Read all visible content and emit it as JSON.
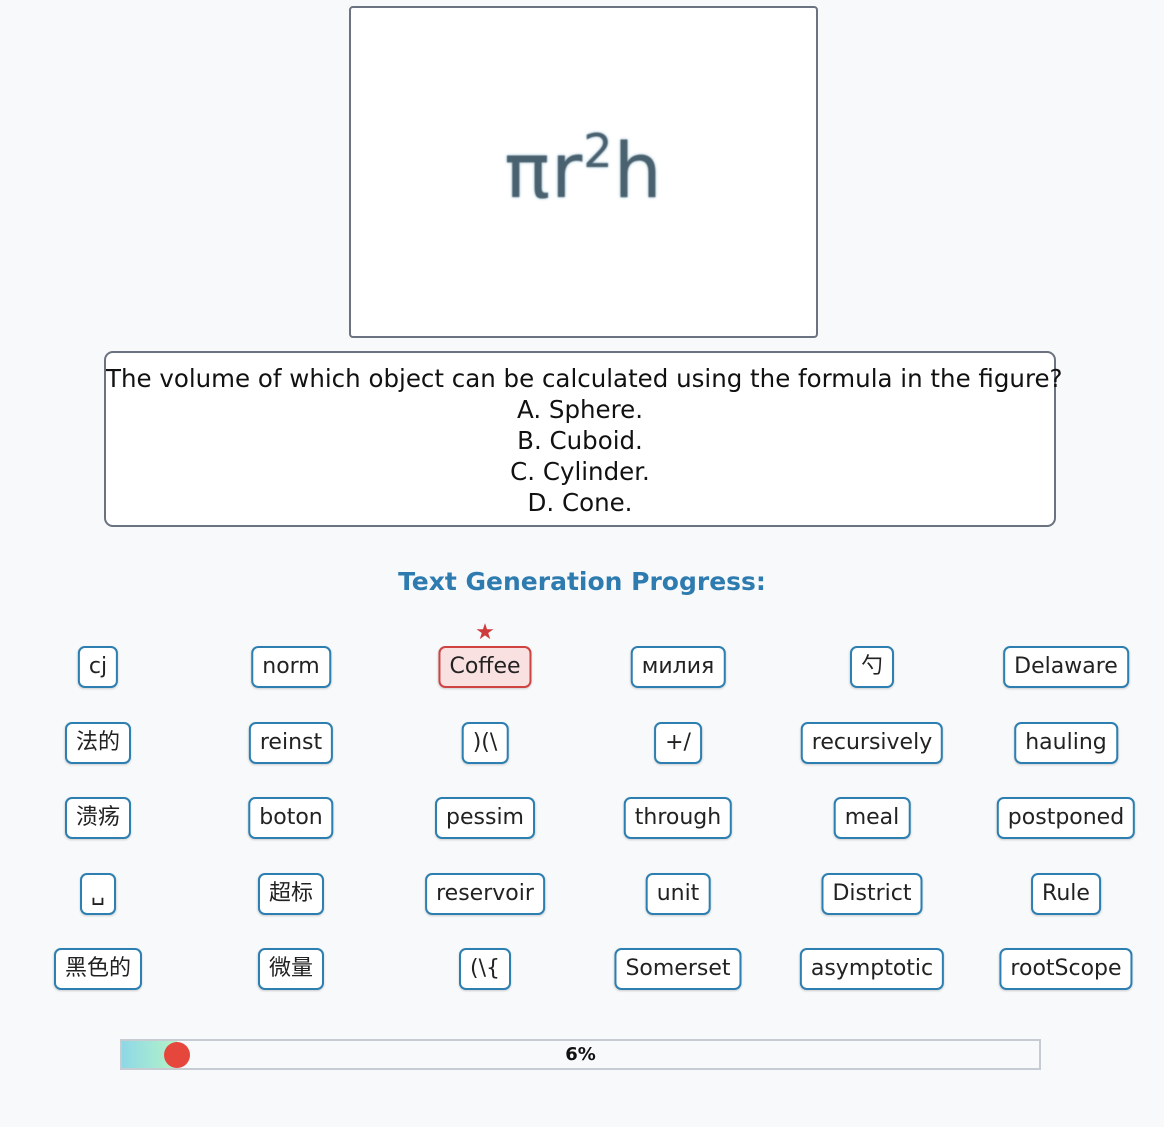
{
  "figure": {
    "formula_base": "πr",
    "formula_exponent": "2",
    "formula_tail": "h"
  },
  "question": {
    "text": "The volume of which object can be calculated using the formula in the figure?",
    "options": [
      "A. Sphere.",
      "B. Cuboid.",
      "C. Cylinder.",
      "D. Cone."
    ]
  },
  "progress_title": "Text Generation Progress:",
  "tokens": [
    [
      "cj",
      "norm",
      "Coffee",
      "милия",
      "勺",
      "Delaware"
    ],
    [
      "法的",
      "reinst",
      ")(\\",
      "+/",
      "recursively",
      "hauling"
    ],
    [
      "溃疡",
      "boton",
      "pessim",
      "through",
      "meal",
      "postponed"
    ],
    [
      "␣",
      "超标",
      "reservoir",
      "unit",
      "District",
      "Rule"
    ],
    [
      "黑色的",
      "微量",
      "(\\{",
      "Somerset",
      "asymptotic",
      "rootScope"
    ]
  ],
  "highlighted_token": "Coffee",
  "progress": {
    "label": "6%",
    "fraction": 0.06
  },
  "colors": {
    "token_border": "#2c7fb0",
    "highlight_border": "#cf4343",
    "highlight_bg": "#fae1e1",
    "title_color": "#2e7bb0",
    "knob": "#e5473c"
  }
}
